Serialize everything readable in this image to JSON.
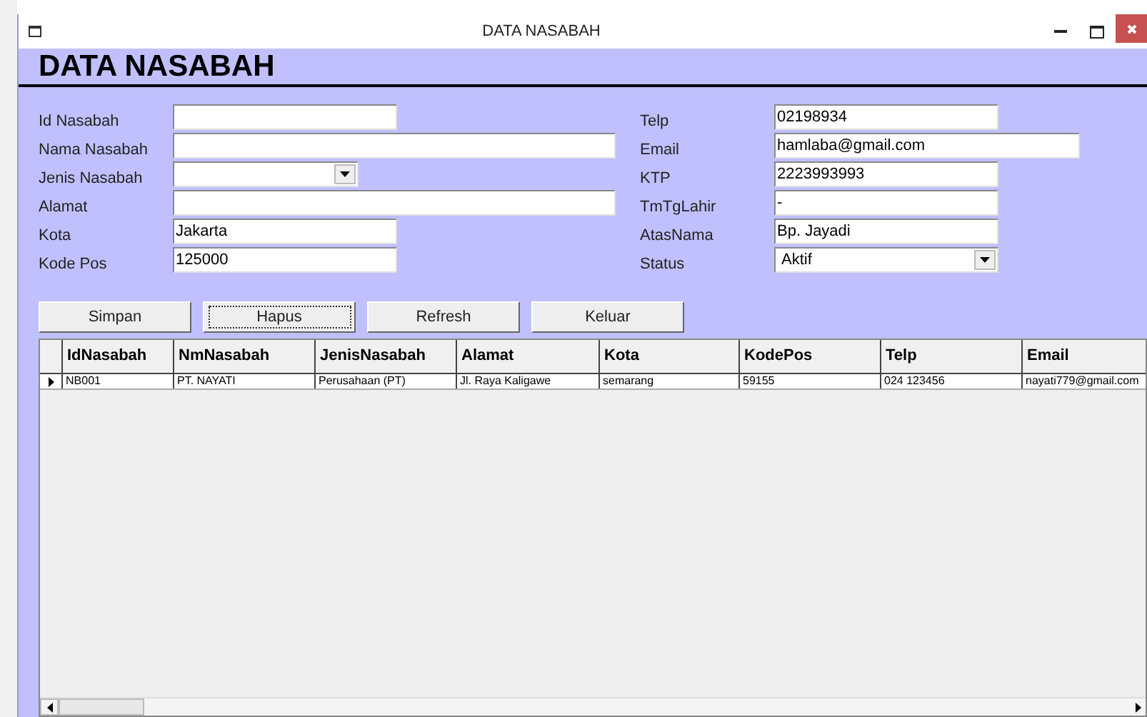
{
  "window": {
    "title": "DATA NASABAH"
  },
  "header": "DATA NASABAH",
  "left_fields": [
    {
      "label": "Id Nasabah",
      "kind": "text"
    },
    {
      "label": "Nama Nasabah",
      "kind": "text"
    },
    {
      "label": "Jenis Nasabah",
      "kind": "combo"
    },
    {
      "label": "Alamat",
      "kind": "text"
    },
    {
      "label": "Kota",
      "kind": "text",
      "value": "Jakarta"
    },
    {
      "label": "Kode Pos",
      "kind": "text",
      "value": "125000"
    }
  ],
  "right_fields": [
    {
      "label": "Telp",
      "kind": "text",
      "value": "02198934"
    },
    {
      "label": "Email",
      "kind": "text",
      "value": "hamlaba@gmail.com"
    },
    {
      "label": "KTP",
      "kind": "text",
      "value": "2223993993"
    },
    {
      "label": "TmTgLahir",
      "kind": "text",
      "value": "-"
    },
    {
      "label": "AtasNama",
      "kind": "text",
      "value": "Bp. Jayadi"
    },
    {
      "label": "Status",
      "kind": "combo",
      "value": "Aktif"
    }
  ],
  "buttons": [
    {
      "label": "Simpan",
      "focused": false
    },
    {
      "label": "Hapus",
      "focused": true
    },
    {
      "label": "Refresh",
      "focused": false
    },
    {
      "label": "Keluar",
      "focused": false
    }
  ],
  "table": {
    "columns": [
      "IdNasabah",
      "NmNasabah",
      "JenisNasabah",
      "Alamat",
      "Kota",
      "KodePos",
      "Telp",
      "Email"
    ],
    "rows": [
      {
        "selected": true,
        "cells": [
          "NB001",
          "PT. NAYATI",
          "Perusahaan (PT)",
          "Jl. Raya Kaligawe",
          "semarang",
          "59155",
          "024 123456",
          "nayati779@gmail.com"
        ]
      }
    ]
  }
}
